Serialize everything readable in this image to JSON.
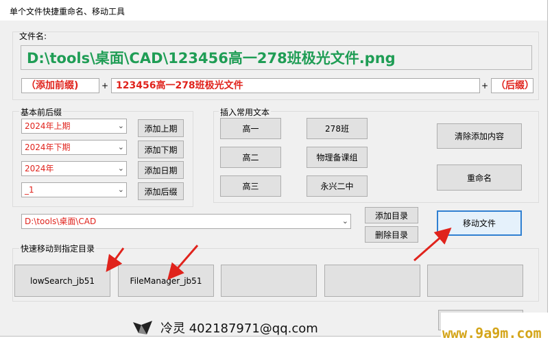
{
  "window": {
    "title": "单个文件快捷重命名、移动工具"
  },
  "filename": {
    "label": "文件名:",
    "value": "D:\\tools\\桌面\\CAD\\123456高一278班极光文件.png"
  },
  "rename": {
    "prefix": "（添加前缀)",
    "plus": "+",
    "name": "123456高一278班极光文件",
    "suffix": "（后缀）"
  },
  "presets": {
    "label": "基本前后缀",
    "rows": [
      {
        "value": "2024年上期",
        "button": "添加上期"
      },
      {
        "value": "2024年下期",
        "button": "添加下期"
      },
      {
        "value": "2024年",
        "button": "添加日期"
      },
      {
        "value": "_1",
        "button": "添加后缀"
      }
    ]
  },
  "insert_text": {
    "label": "插入常用文本",
    "buttons": [
      "高一",
      "高二",
      "高三",
      "278班",
      "物理备课组",
      "永兴二中"
    ],
    "clear_button": "清除添加内容",
    "rename_button": "重命名"
  },
  "directory": {
    "path": "D:\\tools\\桌面\\CAD",
    "add_button": "添加目录",
    "delete_button": "删除目录",
    "move_button": "移动文件"
  },
  "quick_move": {
    "label": "快速移动到指定目录",
    "slots": [
      "lowSearch_jb51",
      "FileManager_jb51",
      "",
      "",
      ""
    ]
  },
  "footer": {
    "contact": "冷灵 402187971@qq.com"
  },
  "watermark": {
    "text": "www.9a9m.com"
  },
  "colors": {
    "accent_green": "#1f9d55",
    "accent_red": "#e0231c",
    "arrow_red": "#e0231c"
  }
}
